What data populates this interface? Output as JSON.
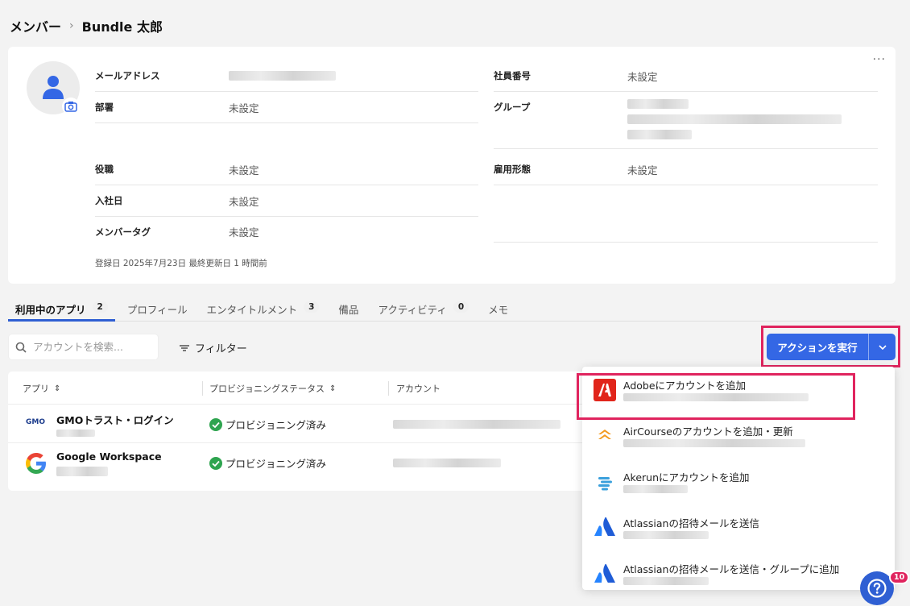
{
  "breadcrumb": {
    "parent": "メンバー",
    "current": "Bundle 太郎"
  },
  "profile": {
    "more_label": "···",
    "fields": {
      "email": {
        "label": "メールアドレス"
      },
      "department": {
        "label": "部署",
        "value": "未設定"
      },
      "position": {
        "label": "役職",
        "value": "未設定"
      },
      "join_date": {
        "label": "入社日",
        "value": "未設定"
      },
      "member_tag": {
        "label": "メンバータグ",
        "value": "未設定"
      },
      "employee_no": {
        "label": "社員番号",
        "value": "未設定"
      },
      "group": {
        "label": "グループ"
      },
      "employment_type": {
        "label": "雇用形態",
        "value": "未設定"
      }
    },
    "meta": "登録日 2025年7月23日  最終更新日 1 時間前"
  },
  "tabs": [
    {
      "label": "利用中のアプリ",
      "count": "2",
      "active": true
    },
    {
      "label": "プロフィール"
    },
    {
      "label": "エンタイトルメント",
      "count": "3"
    },
    {
      "label": "備品"
    },
    {
      "label": "アクティビティ",
      "count": "0"
    },
    {
      "label": "メモ"
    }
  ],
  "search": {
    "placeholder": "アカウントを検索..."
  },
  "filter": {
    "label": "フィルター"
  },
  "action": {
    "label": "アクションを実行"
  },
  "table": {
    "headers": {
      "app": "アプリ",
      "status": "プロビジョニングステータス",
      "account": "アカウント"
    },
    "rows": [
      {
        "app": "GMOトラスト・ログイン",
        "status": "プロビジョニング済み",
        "logo": "GMO"
      },
      {
        "app": "Google Workspace",
        "status": "プロビジョニング済み",
        "logo": "G"
      }
    ]
  },
  "dropdown": {
    "items": [
      {
        "title": "Adobeにアカウントを追加",
        "icon": "adobe-icon"
      },
      {
        "title": "AirCourseのアカウントを追加・更新",
        "icon": "aircourse-icon"
      },
      {
        "title": "Akerunにアカウントを追加",
        "icon": "akerun-icon"
      },
      {
        "title": "Atlassianの招待メールを送信",
        "icon": "atlassian-icon"
      },
      {
        "title": "Atlassianの招待メールを送信・グループに追加",
        "icon": "atlassian-icon"
      }
    ]
  },
  "help": {
    "badge": "10"
  },
  "colors": {
    "accent": "#3467e5",
    "highlight": "#e0245e",
    "success": "#2ea44f"
  }
}
